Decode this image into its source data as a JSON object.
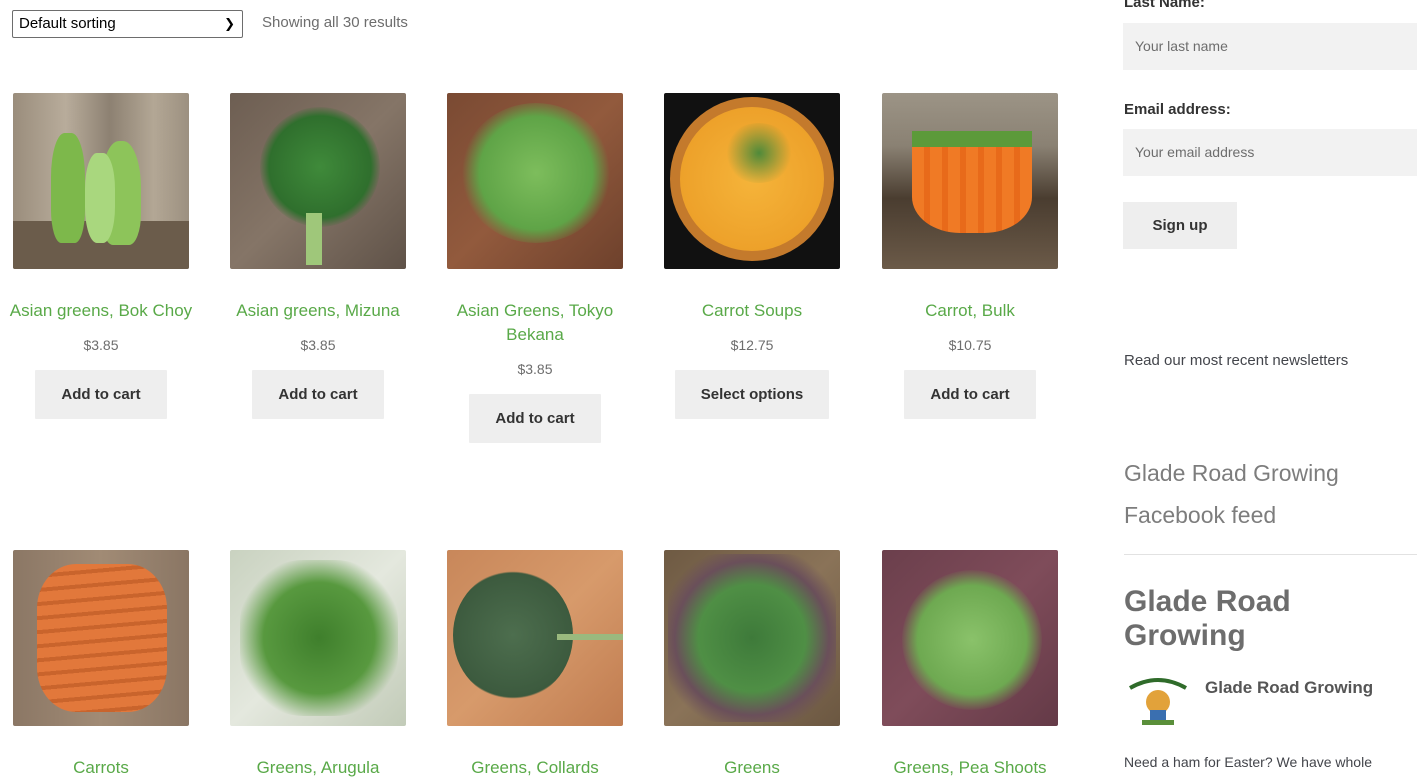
{
  "toolbar": {
    "sort_value": "Default sorting",
    "result_count": "Showing all 30 results"
  },
  "products_row1": [
    {
      "title": "Asian greens, Bok Choy",
      "price": "$3.85",
      "button": "Add to cart"
    },
    {
      "title": "Asian greens, Mizuna",
      "price": "$3.85",
      "button": "Add to cart"
    },
    {
      "title": "Asian Greens, Tokyo Bekana",
      "price": "$3.85",
      "button": "Add to cart"
    },
    {
      "title": "Carrot Soups",
      "price": "$12.75",
      "button": "Select options"
    },
    {
      "title": "Carrot, Bulk",
      "price": "$10.75",
      "button": "Add to cart"
    }
  ],
  "products_row2": [
    {
      "title": "Carrots"
    },
    {
      "title": "Greens, Arugula"
    },
    {
      "title": "Greens, Collards"
    },
    {
      "title": "Greens"
    },
    {
      "title": "Greens, Pea Shoots"
    }
  ],
  "signup_form": {
    "last_name_label": "Last Name:",
    "last_name_placeholder": "Your last name",
    "email_label": "Email address:",
    "email_placeholder": "Your email address",
    "signup_button": "Sign up"
  },
  "sidebar": {
    "newsletters_link": "Read our most recent newsletters",
    "facebook_feed_title": "Glade Road Growing Facebook feed",
    "widget_heading": "Glade Road Growing",
    "fb_page_name": "Glade Road Growing",
    "fb_post_text": "Need a ham for Easter? We have whole"
  },
  "colors": {
    "product_title": "#59a948",
    "button_bg": "#eeeeee",
    "input_bg": "#f2f2f2"
  }
}
